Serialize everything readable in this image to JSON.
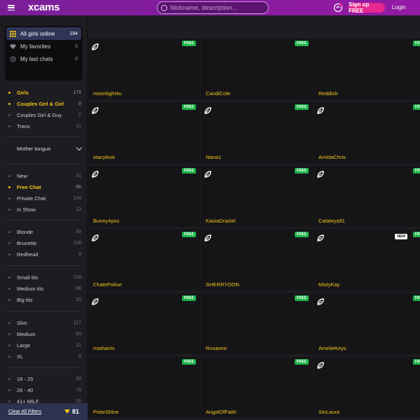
{
  "header": {
    "logo": "xcams",
    "search_placeholder": "Nickname, description...",
    "signup_label": "Sign up FREE",
    "login_label": "Login"
  },
  "sidebar": {
    "quick": [
      {
        "label": "All girls online",
        "count": "194",
        "icon": "grid-icon",
        "active": true
      },
      {
        "label": "My favorites",
        "count": "0",
        "icon": "heart-icon",
        "active": false
      },
      {
        "label": "My last chats",
        "count": "0",
        "icon": "history-icon",
        "active": false
      }
    ],
    "categories": [
      {
        "label": "Girls",
        "count": "179",
        "selected": true
      },
      {
        "label": "Couples Girl & Girl",
        "count": "0",
        "selected": true
      },
      {
        "label": "Couples Girl & Guy",
        "count": "2",
        "selected": false
      },
      {
        "label": "Trans",
        "count": "11",
        "selected": false
      }
    ],
    "mother_tongue_label": "Mother tongue",
    "status": [
      {
        "label": "New",
        "count": "31",
        "selected": false
      },
      {
        "label": "Free Chat",
        "count": "86",
        "selected": true
      },
      {
        "label": "Private Chat",
        "count": "104",
        "selected": false
      },
      {
        "label": "In Show",
        "count": "13",
        "selected": false
      }
    ],
    "hair": [
      {
        "label": "Blonde",
        "count": "69",
        "selected": false
      },
      {
        "label": "Brunette",
        "count": "106",
        "selected": false
      },
      {
        "label": "Redhead",
        "count": "9",
        "selected": false
      }
    ],
    "breasts": [
      {
        "label": "Small tits",
        "count": "118",
        "selected": false
      },
      {
        "label": "Medium tits",
        "count": "66",
        "selected": false
      },
      {
        "label": "Big tits",
        "count": "10",
        "selected": false
      }
    ],
    "body": [
      {
        "label": "Slim",
        "count": "117",
        "selected": false
      },
      {
        "label": "Medium",
        "count": "60",
        "selected": false
      },
      {
        "label": "Large",
        "count": "11",
        "selected": false
      },
      {
        "label": "XL",
        "count": "5",
        "selected": false
      }
    ],
    "age": [
      {
        "label": "18 - 25",
        "count": "90",
        "selected": false
      },
      {
        "label": "26 - 40",
        "count": "75",
        "selected": false
      },
      {
        "label": "41+ MILF",
        "count": "28",
        "selected": false
      }
    ],
    "clear_label": "Clear All Filters",
    "filter_count": "81"
  },
  "badges": {
    "free": "FREE",
    "new": "NEW"
  },
  "models": [
    {
      "name": "moonlight4u",
      "vip": true,
      "free": true,
      "new": false
    },
    {
      "name": "CandiCole",
      "vip": false,
      "free": true,
      "new": false
    },
    {
      "name": "Reddish",
      "vip": false,
      "free": true,
      "new": false
    },
    {
      "name": "stacylove",
      "vip": true,
      "free": true,
      "new": false
    },
    {
      "name": "Nana1",
      "vip": true,
      "free": true,
      "new": false
    },
    {
      "name": "AmidaChris",
      "vip": true,
      "free": true,
      "new": false
    },
    {
      "name": "Bunny4you",
      "vip": true,
      "free": true,
      "new": false
    },
    {
      "name": "KasiaGraziel",
      "vip": true,
      "free": true,
      "new": false
    },
    {
      "name": "Cataleya91",
      "vip": true,
      "free": true,
      "new": false
    },
    {
      "name": "ChatePoilue",
      "vip": true,
      "free": true,
      "new": false
    },
    {
      "name": "SHERRYDON",
      "vip": true,
      "free": true,
      "new": false
    },
    {
      "name": "MistyKay",
      "vip": true,
      "free": true,
      "new": true
    },
    {
      "name": "miaharris",
      "vip": true,
      "free": true,
      "new": false
    },
    {
      "name": "Roxanne",
      "vip": false,
      "free": true,
      "new": false
    },
    {
      "name": "AmelieKeys",
      "vip": true,
      "free": true,
      "new": false
    },
    {
      "name": "PolarShine",
      "vip": false,
      "free": true,
      "new": false
    },
    {
      "name": "AngelOfFaith",
      "vip": false,
      "free": true,
      "new": false
    },
    {
      "name": "SinLaura",
      "vip": true,
      "free": true,
      "new": false
    }
  ],
  "colors": {
    "brand": "#8e1ba3",
    "accent": "#f5c518",
    "free_badge": "#1fb34a",
    "signup": "#e6288f"
  }
}
